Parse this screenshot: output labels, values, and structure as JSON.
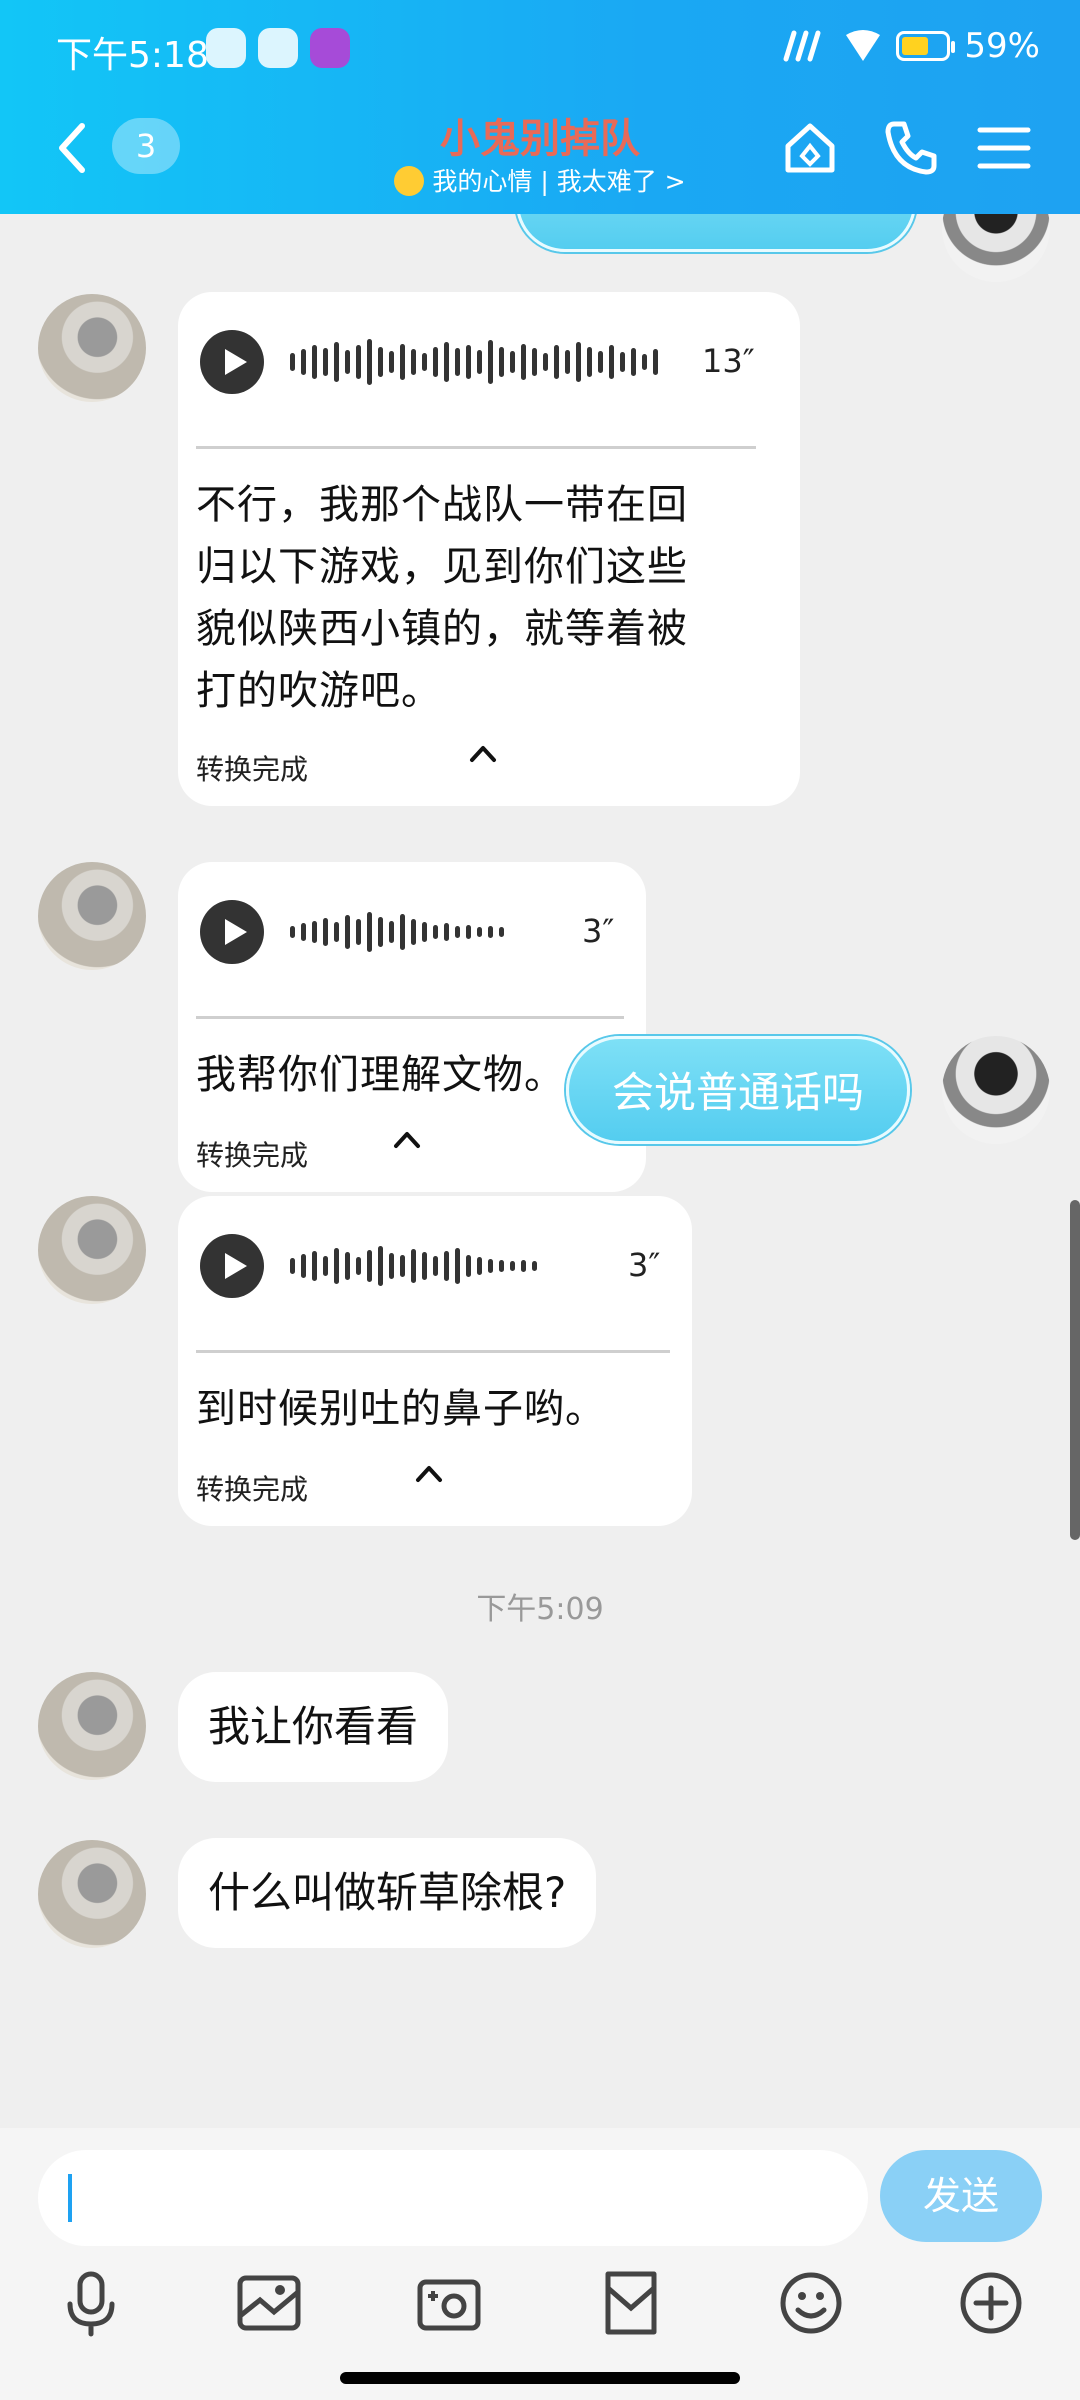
{
  "status_bar": {
    "time": "下午5:18",
    "battery": "59%"
  },
  "header": {
    "unread_count": "3",
    "title": "小鬼别掉队",
    "subtitle": "我的心情 | 我太难了 >"
  },
  "messages": [
    {
      "type": "voice",
      "duration": "13″",
      "text_lines": [
        "不行，我那个战队一带在回",
        "归以下游戏，见到你们这些",
        "貌似陕西小镇的，就等着被",
        "打的吹游吧。"
      ],
      "status": "转换完成"
    },
    {
      "type": "voice",
      "duration": "3″",
      "text_lines": [
        "我帮你们理解文物。"
      ],
      "status": "转换完成"
    },
    {
      "type": "outgoing",
      "text": "会说普通话吗"
    },
    {
      "type": "voice",
      "duration": "3″",
      "text_lines": [
        "到时候别吐的鼻子哟。"
      ],
      "status": "转换完成"
    },
    {
      "type": "timestamp",
      "text": "下午5:09"
    },
    {
      "type": "text",
      "text": "我让你看看"
    },
    {
      "type": "text",
      "text": "什么叫做斩草除根?"
    }
  ],
  "input": {
    "placeholder": "",
    "send_label": "发送"
  },
  "toolbar": [
    "mic-icon",
    "image-icon",
    "camera-icon",
    "file-icon",
    "emoji-icon",
    "plus-icon"
  ],
  "colors": {
    "header_accent": "#1ea2f2",
    "title": "#e86a58",
    "bubble_out": "#54cdf0",
    "send": "#8ad0f6"
  }
}
